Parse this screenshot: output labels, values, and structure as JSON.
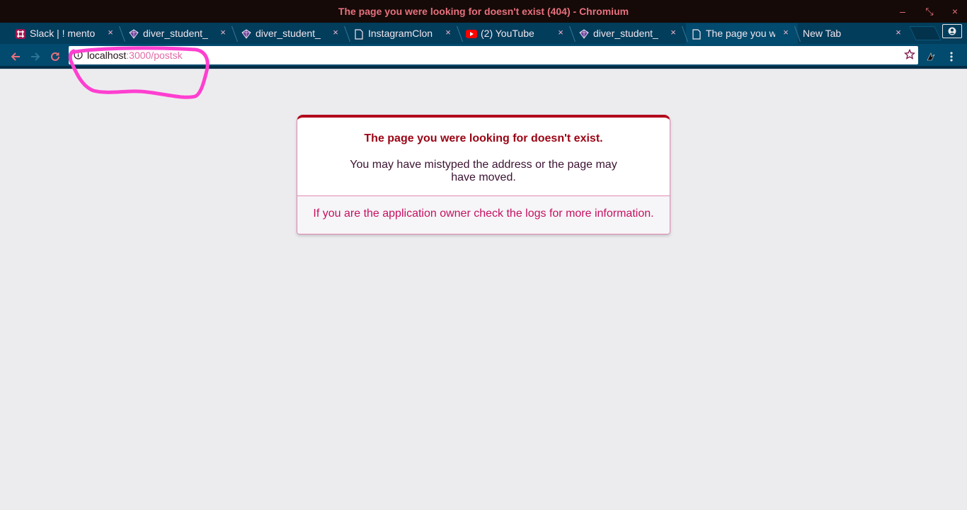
{
  "window": {
    "title": "The page you were looking for doesn't exist (404) - Chromium",
    "controls": {
      "minimize": "–",
      "restore": "⤡",
      "close": "×"
    }
  },
  "tabs": [
    {
      "label": "Slack | ! mento",
      "icon": "slack-icon"
    },
    {
      "label": "diver_student_",
      "icon": "dev-icon"
    },
    {
      "label": "diver_student_",
      "icon": "dev-icon"
    },
    {
      "label": "InstagramClon",
      "icon": "document-icon"
    },
    {
      "label": "(2) YouTube",
      "icon": "youtube-icon"
    },
    {
      "label": "diver_student_",
      "icon": "dev-icon"
    },
    {
      "label": "The page you w",
      "icon": "document-icon",
      "active": true
    },
    {
      "label": "New Tab",
      "icon": ""
    }
  ],
  "tab_close": "×",
  "toolbar": {
    "url_host": "localhost",
    "url_rest": ":3000/postsk"
  },
  "page": {
    "heading": "The page you were looking for doesn't exist.",
    "message": "You may have mistyped the address or the page may have moved.",
    "footer": "If you are the application owner check the logs for more information."
  },
  "colors": {
    "titlebar_bg": "#150a07",
    "title_text": "#e8707e",
    "tabstrip_bg": "#023d5c",
    "toolbar_bg": "#024a6e",
    "heading": "#9a0414",
    "footer_text": "#c51162",
    "highlight": "#ff3fd0",
    "page_bg": "#ececef"
  }
}
